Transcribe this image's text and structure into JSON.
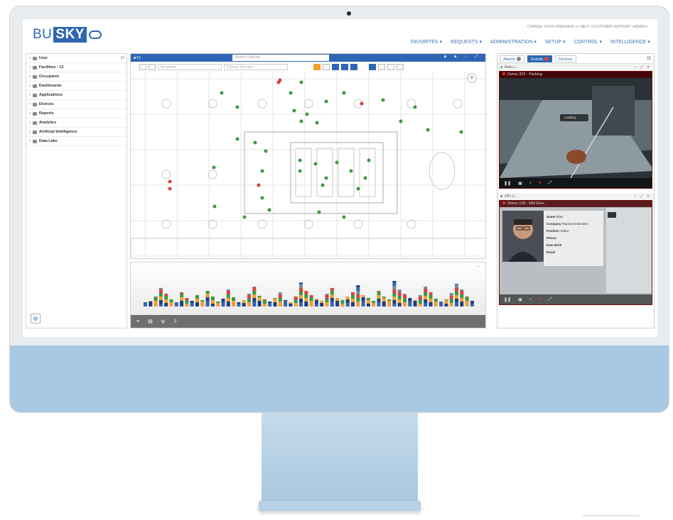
{
  "app": {
    "logo_prefix": "BU",
    "logo_highlight": "SKY",
    "top_links": "CHANGE YOUR LANGUAGE ▾ | HELP | CUSTOMER SUPPORT | ADMIN ▾",
    "nav": [
      "FAVORITES ▾",
      "REQUESTS ▾",
      "ADMINISTRATION ▾",
      "SETUP ▾",
      "CONTROL ▾",
      "INTELLIGENCE ▾"
    ]
  },
  "sidebar": {
    "items": [
      {
        "label": "User",
        "icon": "user-icon"
      },
      {
        "label": "Facilities · 13",
        "icon": "building-icon"
      },
      {
        "label": "Occupants",
        "icon": "people-icon"
      },
      {
        "label": "Dashboards",
        "icon": "dashboard-icon"
      },
      {
        "label": "Applications",
        "icon": "apps-icon"
      },
      {
        "label": "Devices",
        "icon": "device-icon"
      },
      {
        "label": "Reports",
        "icon": "report-icon"
      },
      {
        "label": "Analytics",
        "icon": "analytics-icon"
      },
      {
        "label": "Artificial Intelligence",
        "icon": "ai-icon"
      },
      {
        "label": "Data Lake",
        "icon": "database-icon"
      }
    ]
  },
  "map": {
    "tab_label": "■ F1",
    "search_placeholder": "Search Devices",
    "toolbar_select_1": "No preset",
    "toolbar_select_2": "Choose Function"
  },
  "timeline": {
    "controls": [
      "≡",
      "▤",
      "ψ",
      "⇩"
    ]
  },
  "right_panel": {
    "tabs": [
      {
        "label": "Alarms",
        "badge": "grey"
      },
      {
        "label": "Events",
        "badge": "red"
      },
      {
        "label": "Devices",
        "badge": ""
      }
    ],
    "camera_1": {
      "row_label": "Main L...",
      "title": "Demo 323 - Parking",
      "overlay": "Loading..."
    },
    "camera_2": {
      "row_label": "Off L3...",
      "title": "Demo 135 - Mid Elev...",
      "info_labels": [
        "Name",
        "Company",
        "Position",
        "Phone",
        "Date Birth",
        "Email"
      ],
      "info_values": [
        "Elian",
        "Raymond Mendes",
        "Visitor",
        "",
        "",
        ""
      ]
    }
  },
  "colors": {
    "brand": "#2f66b3",
    "monitor_body": "#a9c8e2",
    "alarm_red": "#e04040",
    "device_green": "#3a9a45"
  }
}
